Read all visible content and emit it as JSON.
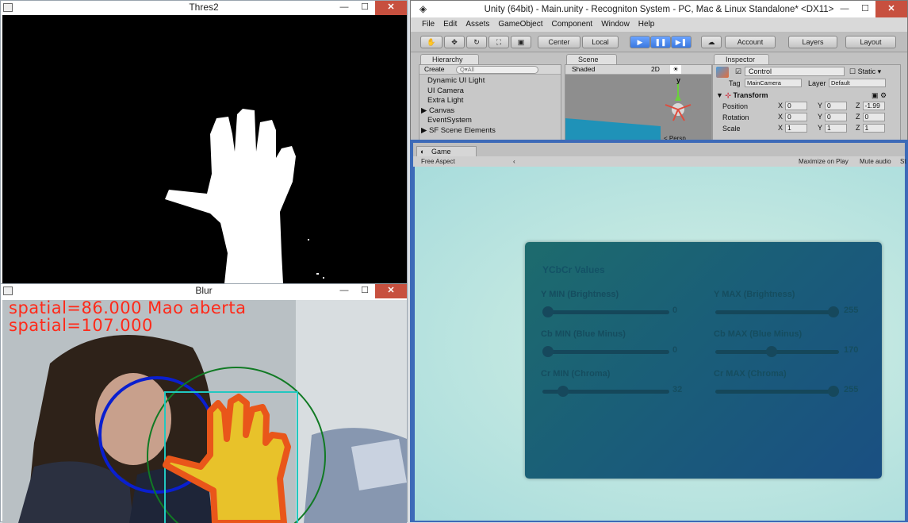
{
  "thres_window": {
    "title": "Thres2",
    "controls": {
      "minimize": "—",
      "maximize": "☐",
      "close": "✕"
    }
  },
  "blur_window": {
    "title": "Blur",
    "overlay_line1": "spatial=86.000  Mao aberta",
    "overlay_line2": "spatial=107.000",
    "controls": {
      "minimize": "—",
      "maximize": "☐",
      "close": "✕"
    }
  },
  "unity": {
    "title": "Unity (64bit) - Main.unity - Recogniton System - PC, Mac & Linux Standalone* <DX11>",
    "controls": {
      "minimize": "—",
      "maximize": "☐",
      "close": "✕"
    },
    "menu": [
      "File",
      "Edit",
      "Assets",
      "GameObject",
      "Component",
      "Window",
      "Help"
    ],
    "toolbar": {
      "center": "Center",
      "local": "Local",
      "play": "▶",
      "pause": "❚❚",
      "step": "▶❚",
      "account": "Account",
      "layers": "Layers",
      "layout": "Layout"
    },
    "hierarchy": {
      "tab": "Hierarchy",
      "create": "Create",
      "search_placeholder": "Q▾All",
      "items": [
        "Dynamic UI Light",
        "UI Camera",
        "Extra Light",
        "▶ Canvas",
        "EventSystem",
        "▶ SF Scene Elements"
      ]
    },
    "scene": {
      "tab": "Scene",
      "shaded": "Shaded",
      "mode_2d": "2D",
      "gizmo_y": "y",
      "persp": "< Persp"
    },
    "inspector": {
      "tab": "Inspector",
      "object_name": "Control",
      "static_label": "Static",
      "tag_label": "Tag",
      "tag_value": "MainCamera",
      "layer_label": "Layer",
      "layer_value": "Default",
      "transform_label": "Transform",
      "position_label": "Position",
      "rotation_label": "Rotation",
      "scale_label": "Scale",
      "x": "X",
      "y": "Y",
      "z": "Z",
      "position": [
        "0",
        "0",
        "-1.99"
      ],
      "rotation": [
        "0",
        "0",
        "0"
      ],
      "scale": [
        "1",
        "1",
        "1"
      ]
    }
  },
  "game": {
    "tab": "Game",
    "aspect": "Free Aspect",
    "maximize_on_play": "Maximize on Play",
    "mute_audio": "Mute audio",
    "stats": "St",
    "panel": {
      "title": "YCbCr Values",
      "sliders": [
        {
          "label": "Y MIN (Brightness)",
          "value": "0",
          "fraction": 0.0
        },
        {
          "label": "Y MAX (Brightness)",
          "value": "255",
          "fraction": 1.0
        },
        {
          "label": "Cb MIN (Blue Minus)",
          "value": "0",
          "fraction": 0.0
        },
        {
          "label": "Cb MAX (Blue Minus)",
          "value": "170",
          "fraction": 0.45
        },
        {
          "label": "Cr MIN (Chroma)",
          "value": "32",
          "fraction": 0.13
        },
        {
          "label": "Cr MAX (Chroma)",
          "value": "255",
          "fraction": 1.0
        }
      ]
    }
  }
}
